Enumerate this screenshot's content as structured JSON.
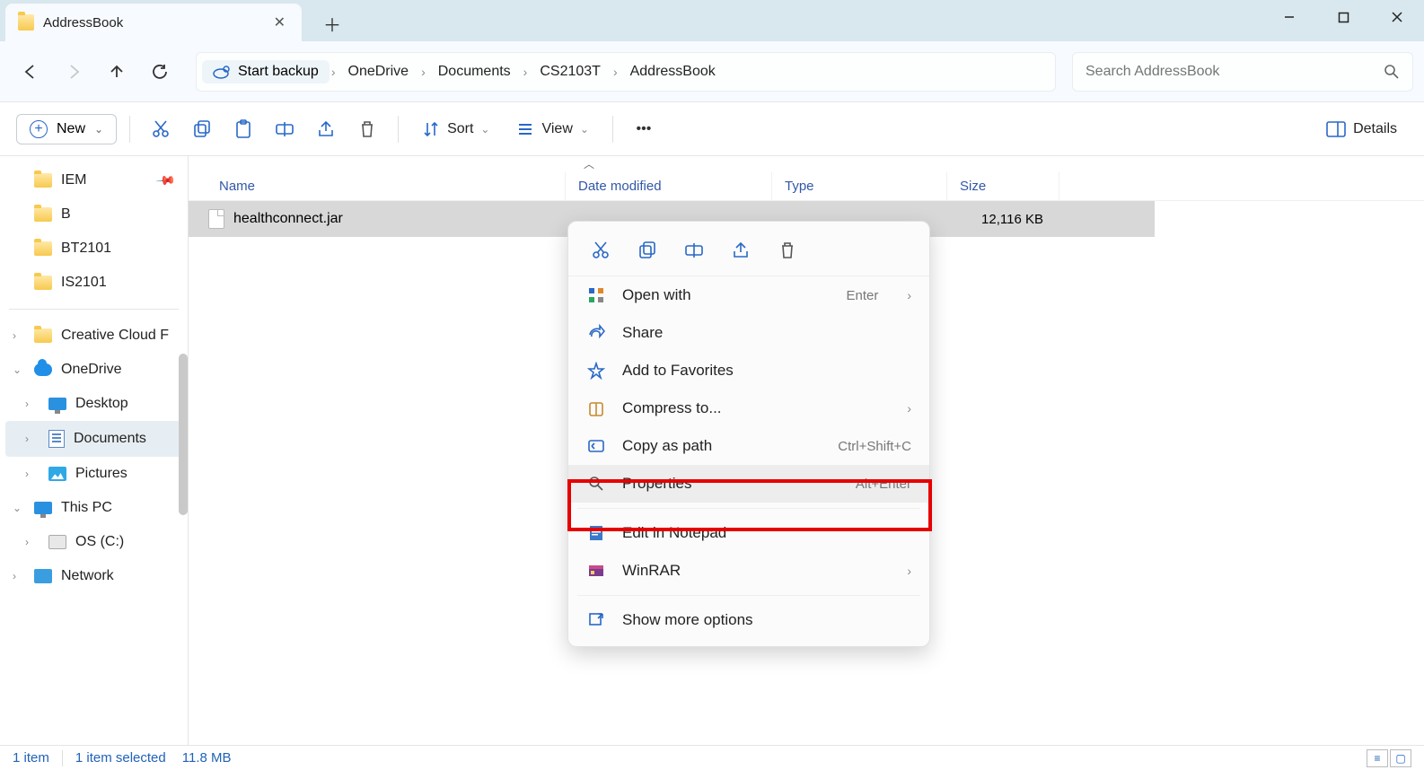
{
  "window": {
    "tab_title": "AddressBook"
  },
  "breadcrumb": {
    "backup_label": "Start backup",
    "items": [
      "OneDrive",
      "Documents",
      "CS2103T",
      "AddressBook"
    ]
  },
  "search": {
    "placeholder": "Search AddressBook"
  },
  "toolbar": {
    "new_label": "New",
    "sort_label": "Sort",
    "view_label": "View",
    "details_label": "Details"
  },
  "sidebar": {
    "quick": [
      {
        "label": "IEM",
        "pinned": true
      },
      {
        "label": "B"
      },
      {
        "label": "BT2101"
      },
      {
        "label": "IS2101"
      }
    ],
    "tree": [
      {
        "label": "Creative Cloud F",
        "icon": "folder",
        "expandable": true,
        "level": 1
      },
      {
        "label": "OneDrive",
        "icon": "cloud",
        "expandable": true,
        "expanded": true,
        "level": 1
      },
      {
        "label": "Desktop",
        "icon": "monitor",
        "expandable": true,
        "level": 2
      },
      {
        "label": "Documents",
        "icon": "doc",
        "expandable": true,
        "level": 2,
        "selected": true
      },
      {
        "label": "Pictures",
        "icon": "pic",
        "expandable": true,
        "level": 2
      },
      {
        "label": "This PC",
        "icon": "monitor",
        "expandable": true,
        "expanded": true,
        "level": 1
      },
      {
        "label": "OS (C:)",
        "icon": "disk",
        "expandable": true,
        "level": 2
      },
      {
        "label": "Network",
        "icon": "net",
        "expandable": true,
        "level": 1
      }
    ]
  },
  "columns": {
    "name": "Name",
    "date": "Date modified",
    "type": "Type",
    "size": "Size"
  },
  "files": [
    {
      "name": "healthconnect.jar",
      "date": "",
      "type": "",
      "size": "12,116 KB"
    }
  ],
  "context_menu": {
    "open_with": {
      "label": "Open with",
      "shortcut": "Enter",
      "submenu": true
    },
    "share": {
      "label": "Share"
    },
    "favorites": {
      "label": "Add to Favorites"
    },
    "compress": {
      "label": "Compress to...",
      "submenu": true
    },
    "copy_path": {
      "label": "Copy as path",
      "shortcut": "Ctrl+Shift+C"
    },
    "properties": {
      "label": "Properties",
      "shortcut": "Alt+Enter"
    },
    "notepad": {
      "label": "Edit in Notepad"
    },
    "winrar": {
      "label": "WinRAR",
      "submenu": true
    },
    "more": {
      "label": "Show more options"
    }
  },
  "statusbar": {
    "count": "1 item",
    "selection": "1 item selected",
    "size": "11.8 MB"
  }
}
